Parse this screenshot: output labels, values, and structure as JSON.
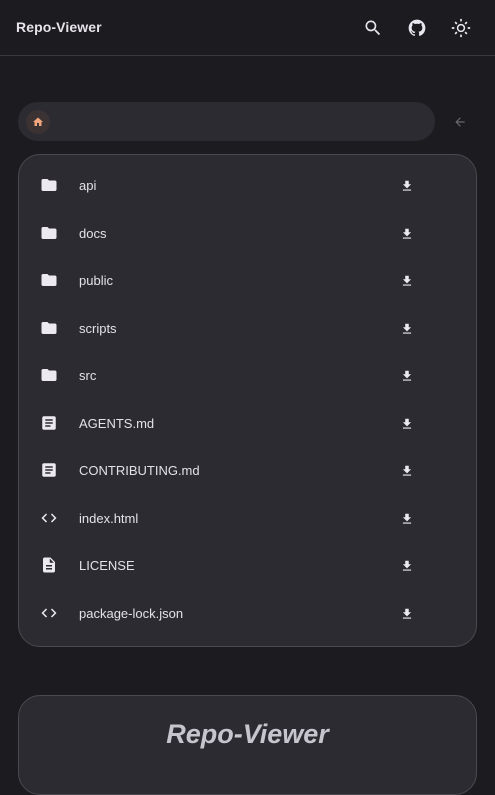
{
  "app": {
    "title": "Repo-Viewer"
  },
  "toolbar": {
    "search_icon": "search-icon",
    "github_icon": "github-icon",
    "theme_icon": "sun-icon"
  },
  "breadcrumb": {
    "home_icon": "home-icon",
    "back_icon": "arrow-back-icon"
  },
  "files": [
    {
      "name": "api",
      "type": "folder"
    },
    {
      "name": "docs",
      "type": "folder"
    },
    {
      "name": "public",
      "type": "folder"
    },
    {
      "name": "scripts",
      "type": "folder"
    },
    {
      "name": "src",
      "type": "folder"
    },
    {
      "name": "AGENTS.md",
      "type": "markdown"
    },
    {
      "name": "CONTRIBUTING.md",
      "type": "markdown"
    },
    {
      "name": "index.html",
      "type": "code"
    },
    {
      "name": "LICENSE",
      "type": "file"
    },
    {
      "name": "package-lock.json",
      "type": "code"
    }
  ],
  "readme": {
    "title": "Repo-Viewer"
  },
  "colors": {
    "background": "#1c1b20",
    "surface": "#2c2b32",
    "accent": "#f0a57c"
  }
}
